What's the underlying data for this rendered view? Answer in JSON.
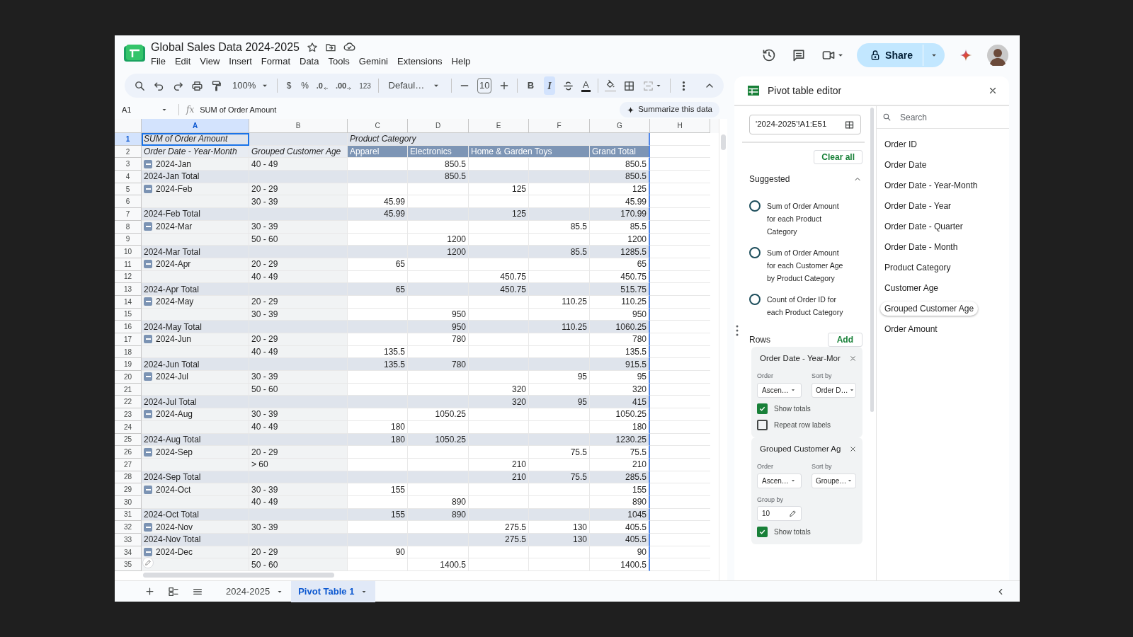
{
  "document": {
    "title": "Global Sales Data 2024-2025"
  },
  "menu": [
    "File",
    "Edit",
    "View",
    "Insert",
    "Format",
    "Data",
    "Tools",
    "Gemini",
    "Extensions",
    "Help"
  ],
  "share": {
    "label": "Share"
  },
  "toolbar": {
    "zoom": "100%",
    "currency": "$",
    "percent": "%",
    "decrease_decimals": ".0",
    "increase_decimals": ".00",
    "number_format": "123",
    "font": "Defaul…",
    "font_size": "10",
    "bold": {
      "label": "B",
      "selected": false
    },
    "italic": {
      "label": "I",
      "selected": true
    },
    "text_color": "A"
  },
  "formula_bar": {
    "name_box": "A1",
    "fx": "fx",
    "formula": "SUM of Order Amount",
    "summarize": "Summarize this data"
  },
  "grid": {
    "columns": [
      {
        "label": "A",
        "selected": true
      },
      {
        "label": "B",
        "selected": false
      },
      {
        "label": "C",
        "selected": false
      },
      {
        "label": "D",
        "selected": false
      },
      {
        "label": "E",
        "selected": false
      },
      {
        "label": "F",
        "selected": false
      },
      {
        "label": "G",
        "selected": false
      },
      {
        "label": "H",
        "selected": false
      }
    ],
    "rows": [
      {
        "number": "1",
        "kind": "title",
        "selected": true,
        "cells": [
          "SUM of Order Amount",
          null,
          "Product Category",
          null,
          null,
          null,
          null
        ]
      },
      {
        "number": "2",
        "kind": "column_headers",
        "selected": false,
        "cells": [
          "Order Date - Year-Month",
          "Grouped Customer Age",
          "Apparel",
          "Electronics",
          "Home & Garden Toys",
          null,
          "Grand Total"
        ]
      },
      {
        "number": "3",
        "kind": "group",
        "selected": false,
        "expanded": true,
        "cells": [
          "2024-Jan",
          "40 - 49",
          null,
          "850.5",
          null,
          null,
          "850.5"
        ]
      },
      {
        "number": "4",
        "kind": "total",
        "selected": false,
        "cells": [
          "2024-Jan Total",
          null,
          null,
          "850.5",
          null,
          null,
          "850.5"
        ]
      },
      {
        "number": "5",
        "kind": "group",
        "selected": false,
        "expanded": true,
        "cells": [
          "2024-Feb",
          "20 - 29",
          null,
          null,
          "125",
          null,
          "125"
        ]
      },
      {
        "number": "6",
        "kind": "detail",
        "selected": false,
        "cells": [
          null,
          "30 - 39",
          "45.99",
          null,
          null,
          null,
          "45.99"
        ]
      },
      {
        "number": "7",
        "kind": "total",
        "selected": false,
        "cells": [
          "2024-Feb Total",
          null,
          "45.99",
          null,
          "125",
          null,
          "170.99"
        ]
      },
      {
        "number": "8",
        "kind": "group",
        "selected": false,
        "expanded": true,
        "cells": [
          "2024-Mar",
          "30 - 39",
          null,
          null,
          null,
          "85.5",
          "85.5"
        ]
      },
      {
        "number": "9",
        "kind": "detail",
        "selected": false,
        "cells": [
          null,
          "50 - 60",
          null,
          "1200",
          null,
          null,
          "1200"
        ]
      },
      {
        "number": "10",
        "kind": "total",
        "selected": false,
        "cells": [
          "2024-Mar Total",
          null,
          null,
          "1200",
          null,
          "85.5",
          "1285.5"
        ]
      },
      {
        "number": "11",
        "kind": "group",
        "selected": false,
        "expanded": true,
        "cells": [
          "2024-Apr",
          "20 - 29",
          "65",
          null,
          null,
          null,
          "65"
        ]
      },
      {
        "number": "12",
        "kind": "detail",
        "selected": false,
        "cells": [
          null,
          "40 - 49",
          null,
          null,
          "450.75",
          null,
          "450.75"
        ]
      },
      {
        "number": "13",
        "kind": "total",
        "selected": false,
        "cells": [
          "2024-Apr Total",
          null,
          "65",
          null,
          "450.75",
          null,
          "515.75"
        ]
      },
      {
        "number": "14",
        "kind": "group",
        "selected": false,
        "expanded": true,
        "cells": [
          "2024-May",
          "20 - 29",
          null,
          null,
          null,
          "110.25",
          "110.25"
        ]
      },
      {
        "number": "15",
        "kind": "detail",
        "selected": false,
        "cells": [
          null,
          "30 - 39",
          null,
          "950",
          null,
          null,
          "950"
        ]
      },
      {
        "number": "16",
        "kind": "total",
        "selected": false,
        "cells": [
          "2024-May Total",
          null,
          null,
          "950",
          null,
          "110.25",
          "1060.25"
        ]
      },
      {
        "number": "17",
        "kind": "group",
        "selected": false,
        "expanded": true,
        "cells": [
          "2024-Jun",
          "20 - 29",
          null,
          "780",
          null,
          null,
          "780"
        ]
      },
      {
        "number": "18",
        "kind": "detail",
        "selected": false,
        "cells": [
          null,
          "40 - 49",
          "135.5",
          null,
          null,
          null,
          "135.5"
        ]
      },
      {
        "number": "19",
        "kind": "total",
        "selected": false,
        "cells": [
          "2024-Jun Total",
          null,
          "135.5",
          "780",
          null,
          null,
          "915.5"
        ]
      },
      {
        "number": "20",
        "kind": "group",
        "selected": false,
        "expanded": true,
        "cells": [
          "2024-Jul",
          "30 - 39",
          null,
          null,
          null,
          "95",
          "95"
        ]
      },
      {
        "number": "21",
        "kind": "detail",
        "selected": false,
        "cells": [
          null,
          "50 - 60",
          null,
          null,
          "320",
          null,
          "320"
        ]
      },
      {
        "number": "22",
        "kind": "total",
        "selected": false,
        "cells": [
          "2024-Jul Total",
          null,
          null,
          null,
          "320",
          "95",
          "415"
        ]
      },
      {
        "number": "23",
        "kind": "group",
        "selected": false,
        "expanded": true,
        "cells": [
          "2024-Aug",
          "30 - 39",
          null,
          "1050.25",
          null,
          null,
          "1050.25"
        ]
      },
      {
        "number": "24",
        "kind": "detail",
        "selected": false,
        "cells": [
          null,
          "40 - 49",
          "180",
          null,
          null,
          null,
          "180"
        ]
      },
      {
        "number": "25",
        "kind": "total",
        "selected": false,
        "cells": [
          "2024-Aug Total",
          null,
          "180",
          "1050.25",
          null,
          null,
          "1230.25"
        ]
      },
      {
        "number": "26",
        "kind": "group",
        "selected": false,
        "expanded": true,
        "cells": [
          "2024-Sep",
          "20 - 29",
          null,
          null,
          null,
          "75.5",
          "75.5"
        ]
      },
      {
        "number": "27",
        "kind": "detail",
        "selected": false,
        "cells": [
          null,
          "> 60",
          null,
          null,
          "210",
          null,
          "210"
        ]
      },
      {
        "number": "28",
        "kind": "total",
        "selected": false,
        "cells": [
          "2024-Sep Total",
          null,
          null,
          null,
          "210",
          "75.5",
          "285.5"
        ]
      },
      {
        "number": "29",
        "kind": "group",
        "selected": false,
        "expanded": true,
        "cells": [
          "2024-Oct",
          "30 - 39",
          "155",
          null,
          null,
          null,
          "155"
        ]
      },
      {
        "number": "30",
        "kind": "detail",
        "selected": false,
        "cells": [
          null,
          "40 - 49",
          null,
          "890",
          null,
          null,
          "890"
        ]
      },
      {
        "number": "31",
        "kind": "total",
        "selected": false,
        "cells": [
          "2024-Oct Total",
          null,
          "155",
          "890",
          null,
          null,
          "1045"
        ]
      },
      {
        "number": "32",
        "kind": "group",
        "selected": false,
        "expanded": true,
        "cells": [
          "2024-Nov",
          "30 - 39",
          null,
          null,
          "275.5",
          "130",
          "405.5"
        ]
      },
      {
        "number": "33",
        "kind": "total",
        "selected": false,
        "cells": [
          "2024-Nov Total",
          null,
          null,
          null,
          "275.5",
          "130",
          "405.5"
        ]
      },
      {
        "number": "34",
        "kind": "group",
        "selected": false,
        "expanded": true,
        "cells": [
          "2024-Dec",
          "20 - 29",
          "90",
          null,
          null,
          null,
          "90"
        ]
      },
      {
        "number": "35",
        "kind": "detail",
        "selected": false,
        "cells": [
          null,
          "50 - 60",
          null,
          "1400.5",
          null,
          null,
          "1400.5"
        ]
      }
    ]
  },
  "sheet_tabs": [
    {
      "label": "2024-2025",
      "selected": false
    },
    {
      "label": "Pivot Table 1",
      "selected": true
    }
  ],
  "pivot_editor": {
    "title": "Pivot table editor",
    "range": "'2024-2025'!A1:E51",
    "clear_all": "Clear all",
    "suggested": {
      "title": "Suggested",
      "expanded": true,
      "items": [
        {
          "text": "Sum of Order Amount for each Product Category",
          "selected": false
        },
        {
          "text": "Sum of Order Amount for each Customer Age by Product Category",
          "selected": false
        },
        {
          "text": "Count of Order ID for each Product Category",
          "selected": false
        }
      ]
    },
    "rows_section": {
      "title": "Rows",
      "add": "Add",
      "fields": [
        {
          "title": "Order Date - Year-Mor",
          "order_label": "Order",
          "order": "Ascen…",
          "sort_label": "Sort by",
          "sort": "Order D…",
          "options": [
            {
              "label": "Show totals",
              "checked": true
            },
            {
              "label": "Repeat row labels",
              "checked": false
            }
          ]
        },
        {
          "title": "Grouped Customer Ag",
          "order_label": "Order",
          "order": "Ascen…",
          "sort_label": "Sort by",
          "sort": "Groupe…",
          "group_by_label": "Group by",
          "group_by": "10",
          "options": [
            {
              "label": "Show totals",
              "checked": true
            }
          ]
        }
      ]
    },
    "search": {
      "placeholder": "Search"
    },
    "fields": [
      {
        "label": "Order ID",
        "selected": false
      },
      {
        "label": "Order Date",
        "selected": false
      },
      {
        "label": "Order Date - Year-Month",
        "selected": false
      },
      {
        "label": "Order Date - Year",
        "selected": false
      },
      {
        "label": "Order Date - Quarter",
        "selected": false
      },
      {
        "label": "Order Date - Month",
        "selected": false
      },
      {
        "label": "Product Category",
        "selected": false
      },
      {
        "label": "Customer Age",
        "selected": false
      },
      {
        "label": "Grouped Customer Age",
        "selected": true
      },
      {
        "label": "Order Amount",
        "selected": false
      }
    ]
  }
}
